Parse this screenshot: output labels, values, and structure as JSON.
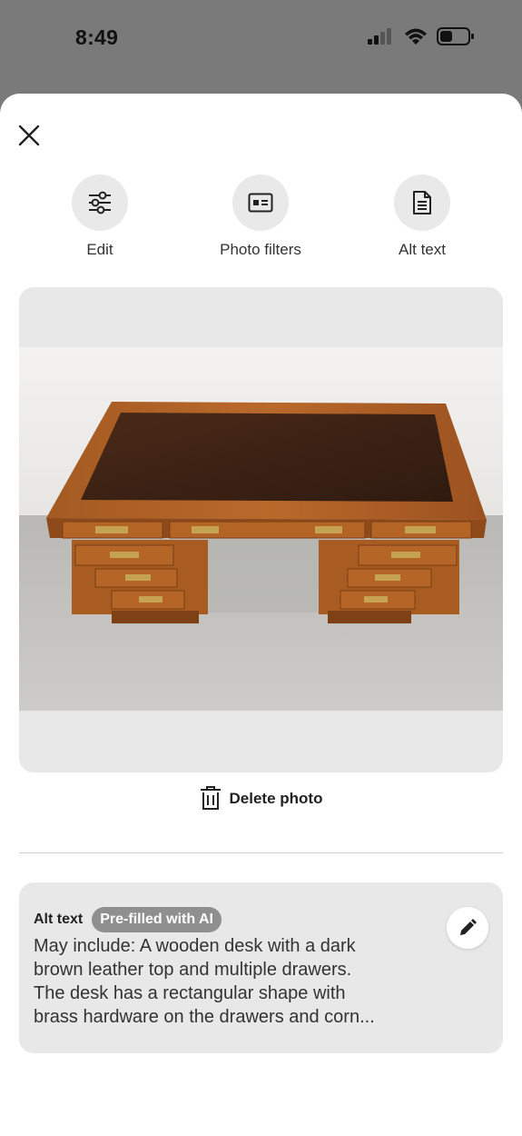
{
  "status": {
    "time": "8:49"
  },
  "actions": [
    {
      "label": "Edit",
      "icon": "sliders-icon"
    },
    {
      "label": "Photo filters",
      "icon": "photo-filter-icon"
    },
    {
      "label": "Alt text",
      "icon": "document-icon"
    }
  ],
  "photo": {
    "alt": "wooden desk photo"
  },
  "delete_label": "Delete photo",
  "alt_text": {
    "title": "Alt text",
    "badge": "Pre-filled with AI",
    "line1": "May include: A wooden desk with a dark",
    "line2": "brown leather top and multiple drawers.",
    "line3": "The desk has a rectangular shape with",
    "line4": "brass hardware on the drawers and corn..."
  },
  "colors": {
    "overlay": "#7a7a7a",
    "card": "#e8e8e8",
    "badge": "#8f8f8f"
  }
}
